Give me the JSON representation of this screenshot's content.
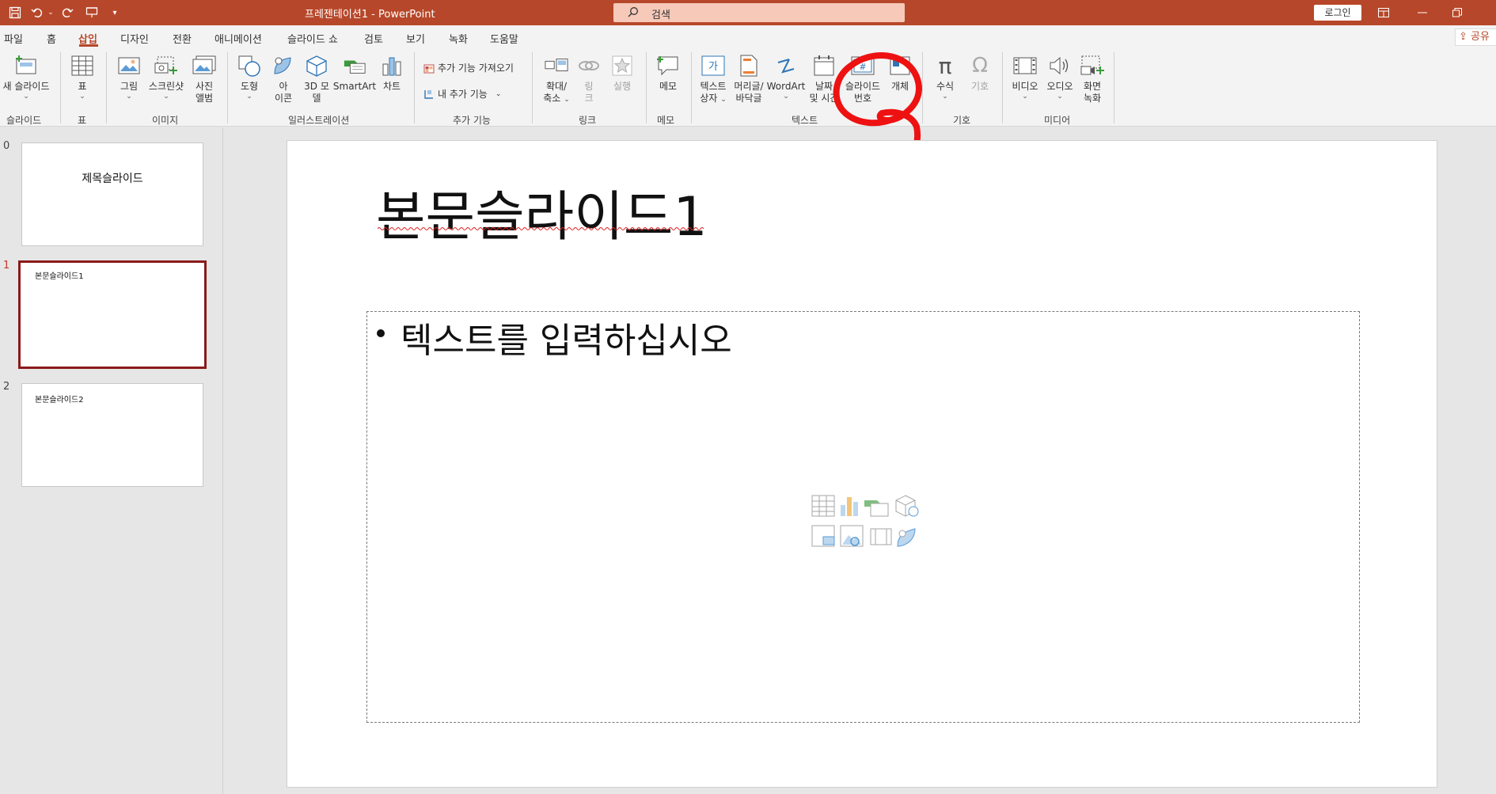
{
  "window": {
    "title": "프레젠테이션1  -  PowerPoint",
    "search_placeholder": "검색",
    "login": "로그인",
    "share": "공유"
  },
  "tabs": [
    {
      "label": "파일",
      "active": false
    },
    {
      "label": "홈",
      "active": false
    },
    {
      "label": "삽입",
      "active": true
    },
    {
      "label": "디자인",
      "active": false
    },
    {
      "label": "전환",
      "active": false
    },
    {
      "label": "애니메이션",
      "active": false
    },
    {
      "label": "슬라이드 쇼",
      "active": false
    },
    {
      "label": "검토",
      "active": false
    },
    {
      "label": "보기",
      "active": false
    },
    {
      "label": "녹화",
      "active": false
    },
    {
      "label": "도움말",
      "active": false
    }
  ],
  "ribbon": {
    "groups": {
      "slides": "슬라이드",
      "table": "표",
      "images": "이미지",
      "illustrations": "일러스트레이션",
      "addins": "추가 기능",
      "links": "링크",
      "comments": "메모",
      "text": "텍스트",
      "symbols": "기호",
      "media": "미디어"
    },
    "buttons": {
      "new_slide": "새 슬라이드",
      "table": "표",
      "pictures": "그림",
      "screenshot": "스크린샷",
      "photo_album_1": "사진",
      "photo_album_2": "앨범",
      "shapes": "도형",
      "icons_1": "아",
      "icons_2": "이콘",
      "model3d_1": "3D 모",
      "model3d_2": "델",
      "smartart": "SmartArt",
      "chart": "차트",
      "get_addins": "추가 기능 가져오기",
      "my_addins": "내 추가 기능",
      "zoom_1": "확대/",
      "zoom_2": "축소",
      "link_1": "링",
      "link_2": "크",
      "action": "실행",
      "comment": "메모",
      "textbox_1": "텍스트",
      "textbox_2": "상자",
      "header_footer_1": "머리글/",
      "header_footer_2": "바닥글",
      "wordart": "WordArt",
      "datetime_1": "날짜",
      "datetime_2": "및 시간",
      "slide_number_1": "슬라이드",
      "slide_number_2": "번호",
      "object_1": "개체",
      "equation": "수식",
      "symbol": "기호",
      "video": "비디오",
      "audio": "오디오",
      "screen_recording_1": "화면",
      "screen_recording_2": "녹화"
    }
  },
  "thumbnails": [
    {
      "num": "0",
      "text": "제목슬라이드"
    },
    {
      "num": "1",
      "text": "본문슬라이드1"
    },
    {
      "num": "2",
      "text": "본문슬라이드2"
    }
  ],
  "slide": {
    "title": "본문슬라이드1",
    "body": "텍스트를 입력하십시오"
  },
  "colors": {
    "accent": "#b7472a",
    "annotation": "#ee1111"
  }
}
